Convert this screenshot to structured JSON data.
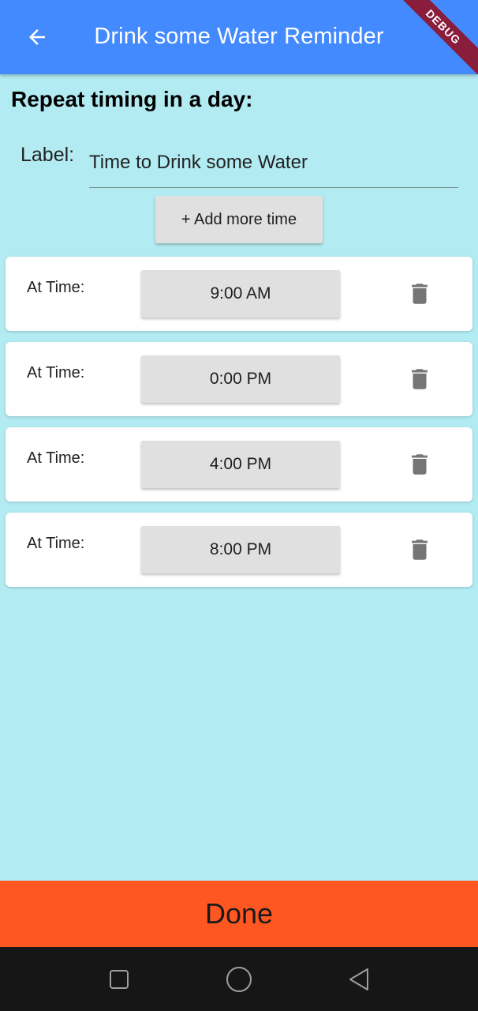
{
  "appbar": {
    "title": "Drink some Water Reminder",
    "back_icon": "arrow-back-icon",
    "debug_banner": "DEBUG",
    "color": "#448aff"
  },
  "section_title": "Repeat timing in a day:",
  "label_field": {
    "label": "Label:",
    "value": "Time to Drink some Water"
  },
  "add_button_label": "+ Add more time",
  "times": [
    {
      "label": "At Time:",
      "time": "9:00 AM",
      "delete_icon": "trash-icon"
    },
    {
      "label": "At Time:",
      "time": "0:00 PM",
      "delete_icon": "trash-icon"
    },
    {
      "label": "At Time:",
      "time": "4:00 PM",
      "delete_icon": "trash-icon"
    },
    {
      "label": "At Time:",
      "time": "8:00 PM",
      "delete_icon": "trash-icon"
    }
  ],
  "done_button_label": "Done",
  "colors": {
    "background": "#b2ebf2",
    "done": "#ff5722",
    "card": "#ffffff",
    "button": "#e0e0e0",
    "icon": "#757575"
  },
  "system_nav": {
    "icons": [
      "recent-apps-icon",
      "home-icon",
      "back-nav-icon"
    ]
  }
}
